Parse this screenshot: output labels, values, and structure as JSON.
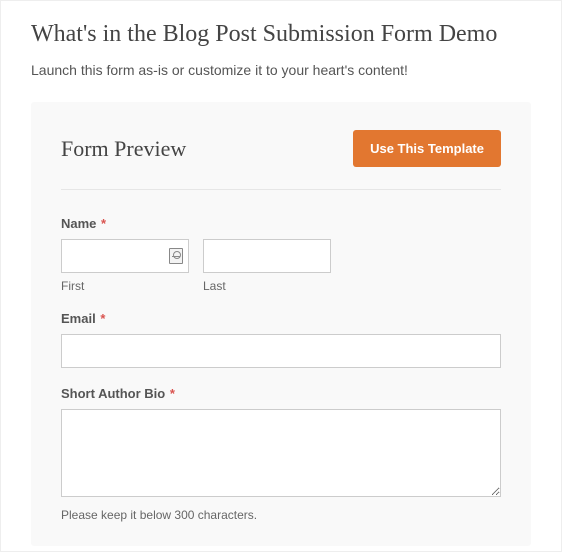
{
  "page": {
    "title": "What's in the Blog Post Submission Form Demo",
    "subtitle": "Launch this form as-is or customize it to your heart's content!"
  },
  "preview": {
    "heading": "Form Preview",
    "cta_label": "Use This Template"
  },
  "fields": {
    "name": {
      "label": "Name",
      "required_marker": "*",
      "first": {
        "sublabel": "First",
        "value": ""
      },
      "last": {
        "sublabel": "Last",
        "value": ""
      }
    },
    "email": {
      "label": "Email",
      "required_marker": "*",
      "value": ""
    },
    "bio": {
      "label": "Short Author Bio",
      "required_marker": "*",
      "value": "",
      "helper": "Please keep it below 300 characters."
    }
  }
}
